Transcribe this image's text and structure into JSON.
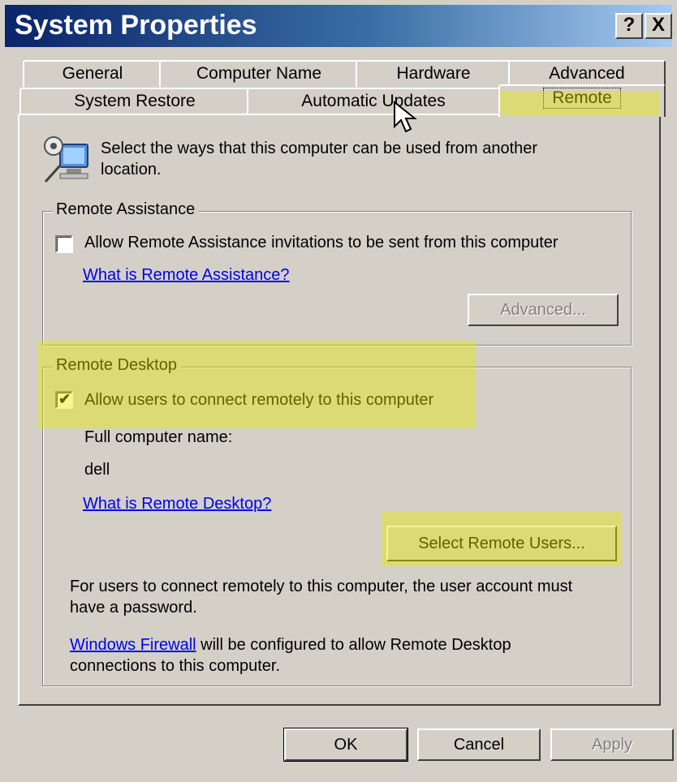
{
  "window": {
    "title": "System Properties",
    "help_button": "?",
    "close_button": "X"
  },
  "tabs": {
    "row1": [
      "General",
      "Computer Name",
      "Hardware",
      "Advanced"
    ],
    "row2": [
      "System Restore",
      "Automatic Updates",
      "Remote"
    ],
    "active": "Remote"
  },
  "intro": {
    "line1": "Select the ways that this computer can be used from another",
    "line2": "location.",
    "icon": "computer-remote-icon"
  },
  "remote_assistance": {
    "group_label": "Remote Assistance",
    "checkbox_label": "Allow Remote Assistance invitations to be sent from this computer",
    "checked": false,
    "link": "What is Remote Assistance?",
    "advanced_button": "Advanced..."
  },
  "remote_desktop": {
    "group_label": "Remote Desktop",
    "checkbox_label": "Allow users to connect remotely to this computer",
    "checked": true,
    "full_name_label": "Full computer name:",
    "full_name_value": "dell",
    "link": "What is Remote Desktop?",
    "select_users_button": "Select Remote Users...",
    "password_note_line1": "For users to connect remotely to this computer, the user account must",
    "password_note_line2": "have a password.",
    "firewall_link": "Windows Firewall",
    "firewall_text_line1": " will be configured to allow Remote Desktop",
    "firewall_text_line2": "connections to this computer."
  },
  "footer": {
    "ok": "OK",
    "cancel": "Cancel",
    "apply": "Apply"
  },
  "colors": {
    "titlebar_start": "#0a246a",
    "titlebar_end": "#a6caf0",
    "face": "#d4d0c8",
    "highlight": "#e6e600",
    "link": "#0000ee"
  }
}
